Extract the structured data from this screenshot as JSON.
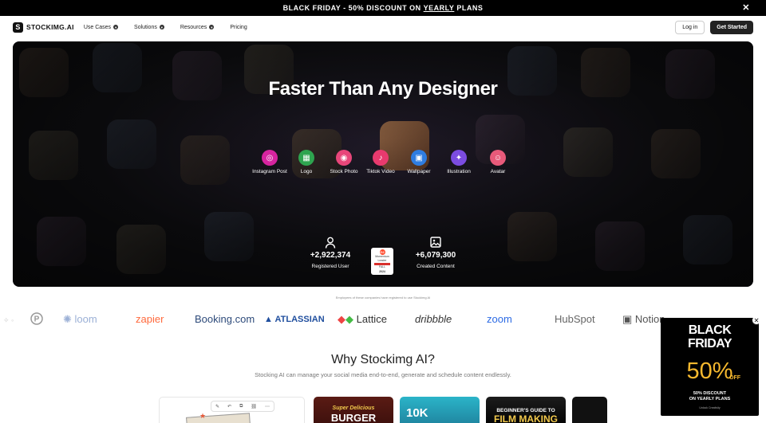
{
  "promo": {
    "text_before": "BLACK FRIDAY - 50% DISCOUNT ON ",
    "underlined": "YEARLY",
    "text_after": " PLANS",
    "close": "✕"
  },
  "nav": {
    "logo_text": "STOCKIMG.AI",
    "menu": [
      "Use Cases",
      "Solutions",
      "Resources",
      "Pricing"
    ],
    "login": "Log in",
    "cta": "Get Started"
  },
  "hero": {
    "title": "Faster Than Any Designer",
    "features": [
      {
        "label": "Instagram Post",
        "icon": "instagram-icon",
        "color": "#d6249f"
      },
      {
        "label": "Logo",
        "icon": "grid-icon",
        "color": "#2ea44f"
      },
      {
        "label": "Stock Photo",
        "icon": "camera-icon",
        "color": "#e8467a"
      },
      {
        "label": "Tiktok Video",
        "icon": "tiktok-icon",
        "color": "#e83a6e"
      },
      {
        "label": "Wallpaper",
        "icon": "image-icon",
        "color": "#2f7de1"
      },
      {
        "label": "Illustration",
        "icon": "sparkle-icon",
        "color": "#7b4ce0"
      },
      {
        "label": "Avatar",
        "icon": "person-icon",
        "color": "#e85a7a"
      }
    ],
    "stats": [
      {
        "value": "+2,922,374",
        "label": "Registered User",
        "icon": "user-icon"
      },
      {
        "value": "+6,079,300",
        "label": "Created Content",
        "icon": "picture-icon"
      }
    ],
    "badge": {
      "logo": "G2",
      "text1": "Momentum",
      "text2": "Leader",
      "season": "FALL",
      "year": "2024"
    }
  },
  "logos": {
    "caption": "Employees of these companies have registered to use Stockimg AI",
    "brands": [
      "loom",
      "zapier",
      "Booking.com",
      "ATLASSIAN",
      "Lattice",
      "dribbble",
      "zoom",
      "HubSpot",
      "Notion"
    ]
  },
  "why": {
    "title": "Why Stockimg AI?",
    "subtitle": "Stocking AI can manage your social media end-to-end, generate and schedule content endlessly."
  },
  "cards": {
    "burger_line1": "Super Delicious",
    "burger_line2": "BURGER",
    "tenk": "10K",
    "film_line1": "BEGINNER'S GUIDE TO",
    "film_line2": "FILM MAKING"
  },
  "popup": {
    "line1": "BLACK",
    "line2": "FRIDAY",
    "percent": "50%",
    "off": "OFF",
    "desc_line1": "50% DISCOUNT",
    "desc_line2": "ON YEARLY PLANS",
    "fine": "Unlock Creativity",
    "close": "✕"
  }
}
